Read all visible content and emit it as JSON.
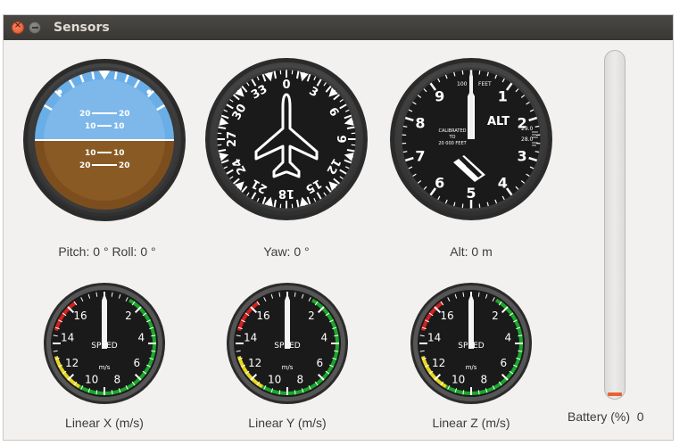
{
  "window": {
    "title": "Sensors",
    "close_symbol": "×"
  },
  "attitude": {
    "pitch_label": "Pitch:",
    "pitch_value": "0",
    "roll_label": "Roll:",
    "roll_value": "0",
    "degree_symbol": "°",
    "ladder": [
      "20",
      "10",
      "10",
      "20"
    ]
  },
  "heading": {
    "yaw_label": "Yaw:",
    "yaw_value": "0",
    "degree_symbol": "°",
    "dial": [
      "0",
      "3",
      "6",
      "9",
      "12",
      "15",
      "18",
      "21",
      "24",
      "27",
      "30",
      "33"
    ]
  },
  "altimeter": {
    "alt_label": "Alt:",
    "alt_value": "0",
    "unit": "m",
    "dial": [
      "0",
      "1",
      "2",
      "3",
      "4",
      "5",
      "6",
      "7",
      "8",
      "9"
    ],
    "face_label": "ALT",
    "calibrated_text": [
      "CALIBRATED",
      "TO",
      "20 000 FEET"
    ],
    "top_text": [
      "100",
      "FEET"
    ],
    "pressure": [
      "29.0",
      "28.0"
    ]
  },
  "speed_gauges": [
    {
      "label": "Linear X (m/s)",
      "value": 0
    },
    {
      "label": "Linear Y (m/s)",
      "value": 0
    },
    {
      "label": "Linear Z (m/s)",
      "value": 0
    }
  ],
  "speed_dial": {
    "numbers": [
      "0",
      "2",
      "4",
      "6",
      "8",
      "10",
      "12",
      "14",
      "16"
    ],
    "name": "SPEED",
    "unit": "m/s"
  },
  "battery": {
    "label": "Battery (%)",
    "value": "0",
    "level_percent": 0
  },
  "colors": {
    "bezel": "#4a4a4a",
    "face": "#1a1a1a",
    "sky": "#6aaee8",
    "ground": "#7d4e1d",
    "arc_red": "#d42020",
    "arc_yellow": "#e8d820",
    "arc_green": "#1aa82a",
    "battery_fill": "#e8632f"
  }
}
